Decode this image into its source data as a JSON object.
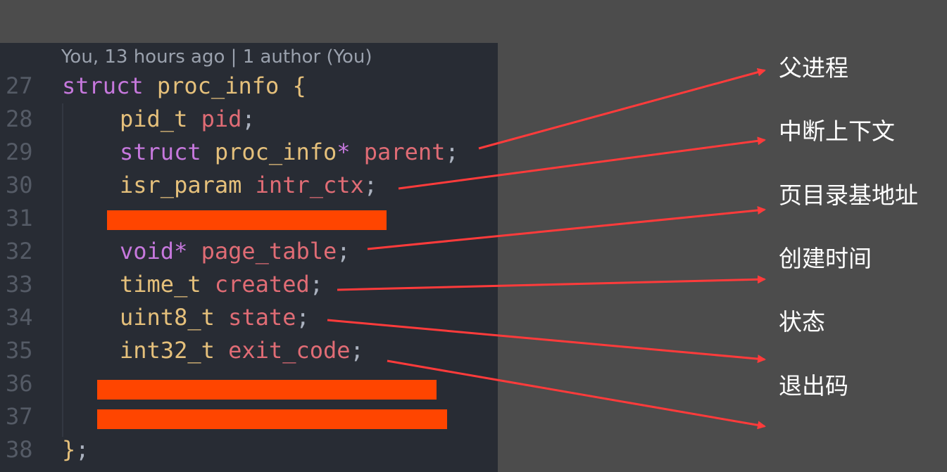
{
  "editor": {
    "codelens": "You, 13 hours ago | 1 author (You)",
    "lines": {
      "l27": {
        "num": "27",
        "t1": "struct",
        "t2": " ",
        "t3": "proc_info",
        "t4": " ",
        "t5": "{"
      },
      "l28": {
        "num": "28",
        "t1": "pid_t",
        "t2": " ",
        "t3": "pid",
        "t4": ";"
      },
      "l29": {
        "num": "29",
        "t1": "struct",
        "t2": " ",
        "t3": "proc_info",
        "t4": "*",
        "t5": " ",
        "t6": "parent",
        "t7": ";"
      },
      "l30": {
        "num": "30",
        "t1": "isr_param",
        "t2": " ",
        "t3": "intr_ctx",
        "t4": ";"
      },
      "l31": {
        "num": "31"
      },
      "l32": {
        "num": "32",
        "t1": "void",
        "t2": "*",
        "t3": " ",
        "t4": "page_table",
        "t5": ";"
      },
      "l33": {
        "num": "33",
        "t1": "time_t",
        "t2": " ",
        "t3": "created",
        "t4": ";"
      },
      "l34": {
        "num": "34",
        "t1": "uint8_t",
        "t2": " ",
        "t3": "state",
        "t4": ";"
      },
      "l35": {
        "num": "35",
        "t1": "int32_t",
        "t2": " ",
        "t3": "exit_code",
        "t4": ";"
      },
      "l36": {
        "num": "36"
      },
      "l37": {
        "num": "37"
      },
      "l38": {
        "num": "38",
        "t1": "}",
        "t2": ";"
      }
    }
  },
  "annotations": {
    "parent_label": "父进程",
    "intr_ctx_label": "中断上下文",
    "page_table_label": "页目录基地址",
    "created_label": "创建时间",
    "state_label": "状态",
    "exit_code_label": "退出码"
  },
  "colors": {
    "background": "#4c4c4c",
    "editor_background": "#282c34",
    "redaction": "#ff4500",
    "arrow": "#ff3b3b",
    "keyword": "#c678dd",
    "type": "#e5c07b",
    "variable": "#e06c75"
  }
}
